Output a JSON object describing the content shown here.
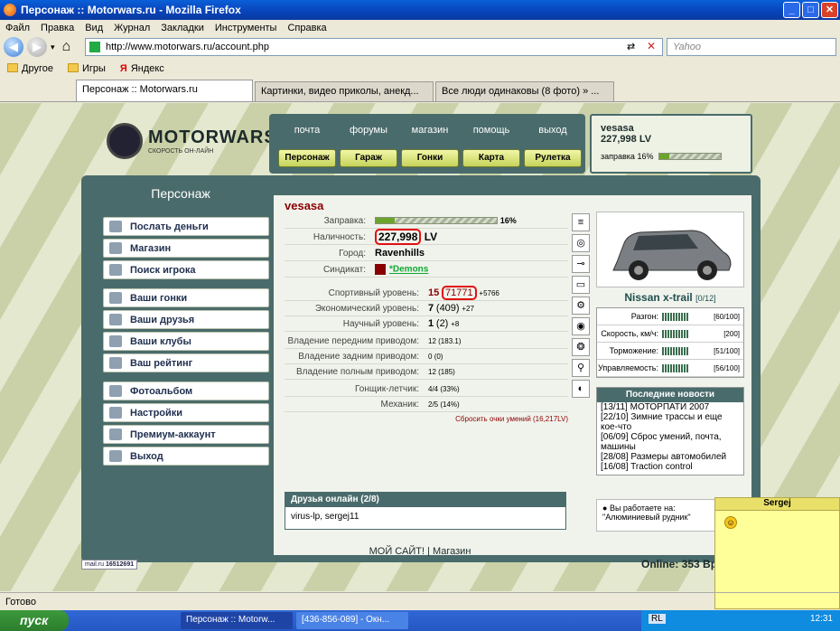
{
  "window": {
    "title": "Персонаж :: Motorwars.ru - Mozilla Firefox"
  },
  "menu": [
    "Файл",
    "Правка",
    "Вид",
    "Журнал",
    "Закладки",
    "Инструменты",
    "Справка"
  ],
  "url": "http://www.motorwars.ru/account.php",
  "search_placeholder": "Yahoo",
  "bookmarks": [
    "Другое",
    "Игры",
    "Яндекс"
  ],
  "tabs": [
    "Персонаж :: Motorwars.ru",
    "Картинки, видео приколы, анекд...",
    "Все люди одинаковы (8 фото) » ..."
  ],
  "site": {
    "logo": "MOTORWARS.RU",
    "logo_sub": "СКОРОСТЬ ОН-ЛАЙН",
    "nav_top": [
      "почта",
      "форумы",
      "магазин",
      "помощь",
      "выход"
    ],
    "nav_bottom": [
      "Персонаж",
      "Гараж",
      "Гонки",
      "Карта",
      "Рулетка"
    ],
    "user": {
      "name": "vesasa",
      "money": "227,998 LV",
      "fuel_label": "заправка 16%",
      "fuel_level": 0.16
    }
  },
  "left": {
    "heading": "Персонаж",
    "items": [
      "Послать деньги",
      "Магазин",
      "Поиск игрока",
      "Ваши гонки",
      "Ваши друзья",
      "Ваши клубы",
      "Ваш рейтинг",
      "Фотоальбом",
      "Настройки",
      "Премиум-аккаунт",
      "Выход"
    ]
  },
  "profile": {
    "name": "vesasa",
    "fuel": {
      "label": "Заправка:",
      "value": "16%",
      "level": 0.16
    },
    "cash": {
      "label": "Наличность:",
      "value": "227,998",
      "unit": "LV"
    },
    "city": {
      "label": "Город:",
      "value": "Ravenhills"
    },
    "syndicate": {
      "label": "Синдикат:",
      "value": "*Demons"
    },
    "sport": {
      "label": "Спортивный уровень:",
      "level": "15",
      "points": "71771",
      "delta": "+5766"
    },
    "eco": {
      "label": "Экономический уровень:",
      "level": "7",
      "points": "(409)",
      "delta": "+27"
    },
    "sci": {
      "label": "Научный уровень:",
      "level": "1",
      "points": "(2)",
      "delta": "+8"
    },
    "front": {
      "label": "Владение передним приводом:",
      "value": "12",
      "pct": "(183.1)"
    },
    "rear": {
      "label": "Владение задним приводом:",
      "value": "0",
      "pct": "(0)"
    },
    "full": {
      "label": "Владение полным приводом:",
      "value": "12",
      "pct": "(185)"
    },
    "pilot": {
      "label": "Гонщик-летчик:",
      "value": "4/4",
      "pct": "(33%)"
    },
    "mech": {
      "label": "Механик:",
      "value": "2/5",
      "pct": "(14%)"
    },
    "reset": "Сбросить очки умений (16,217LV)"
  },
  "car": {
    "name": "Nissan x-trail",
    "slots": "[0/12]",
    "stats": [
      {
        "label": "Разгон:",
        "value": "[60/100]"
      },
      {
        "label": "Скорость, км/ч:",
        "value": "[200]"
      },
      {
        "label": "Торможение:",
        "value": "[51/100]"
      },
      {
        "label": "Управляемость:",
        "value": "[56/100]"
      }
    ]
  },
  "news": {
    "title": "Последние новости",
    "items": [
      "[13/11] МОТОРПАТИ 2007",
      "[22/10] Зимние трассы и еще кое-что",
      "[06/09] Сброс умений, почта, машины",
      "[28/08] Размеры автомобилей",
      "[16/08] Traction control"
    ]
  },
  "friends": {
    "title": "Друзья онлайн (2/8)",
    "list": "virus-lp, sergej11"
  },
  "work": {
    "label": "Вы работаете на:",
    "value": "\"Алюминиевый рудник\""
  },
  "footer": {
    "links": "МОЙ САЙТ! | Магазин",
    "online": "Online: 353",
    "counter": "16512691",
    "counter_label": "mail.ru",
    "time_label": "Вре"
  },
  "sticky": {
    "name": "Sergej"
  },
  "status": "Готово",
  "taskbar": {
    "start": "пуск",
    "items": [
      "Персонаж :: Motorw...",
      "[436-856-089] - Окн..."
    ],
    "lang": "RL",
    "clock": "12:31"
  }
}
